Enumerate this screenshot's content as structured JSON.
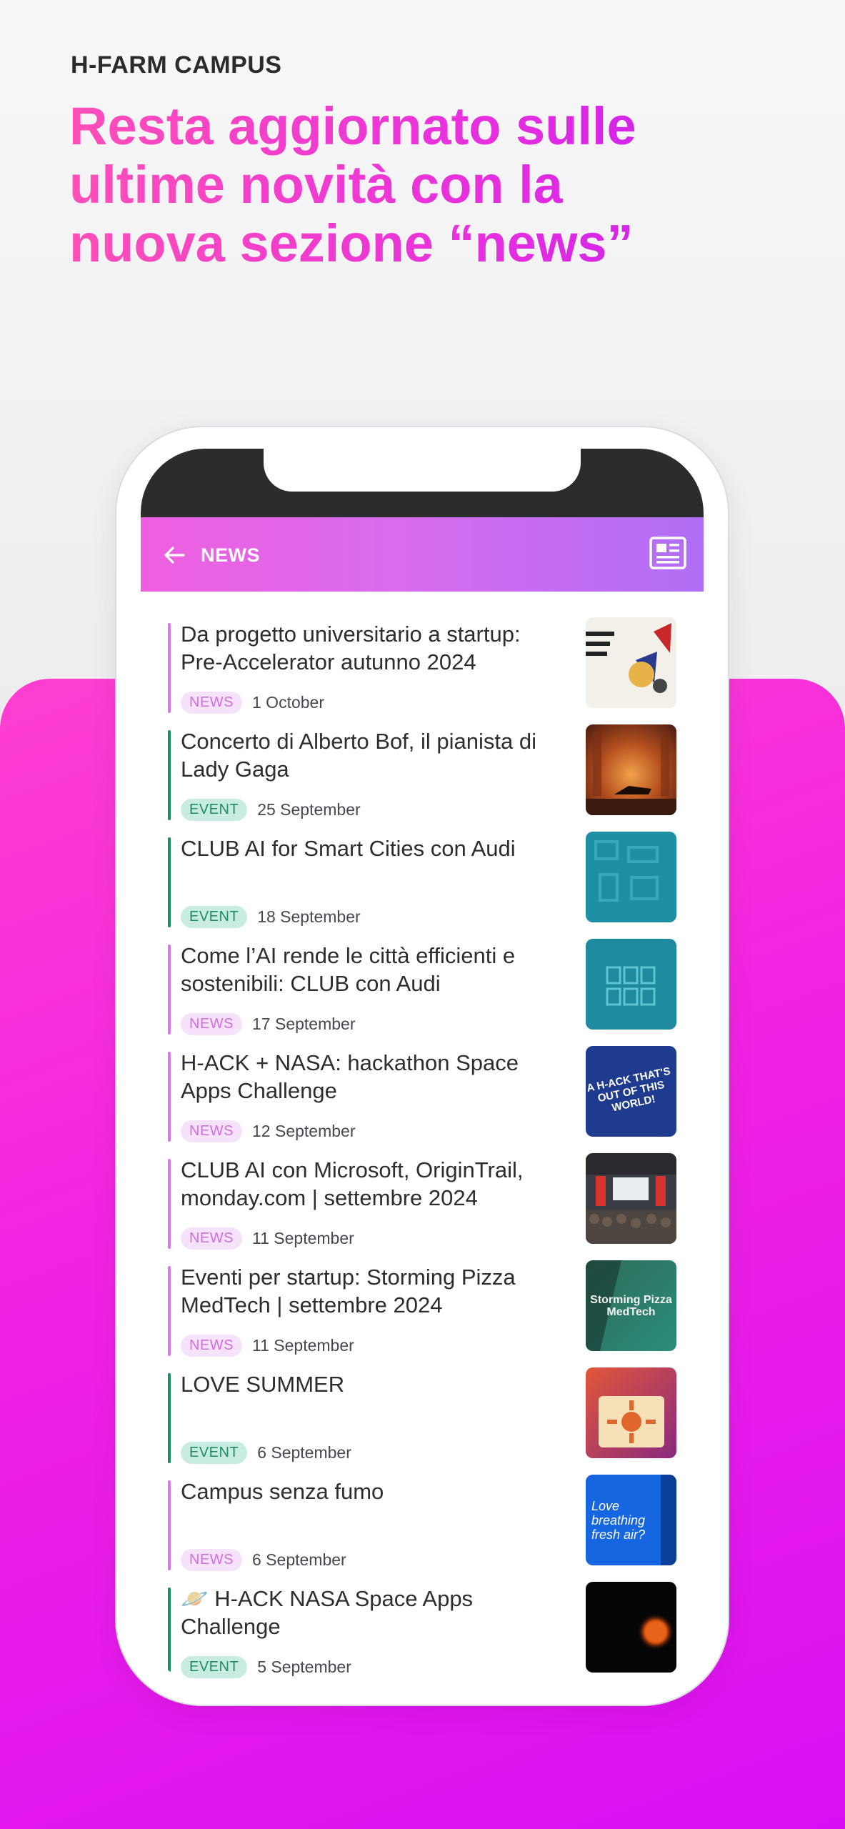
{
  "header": {
    "brand": "H-FARM CAMPUS",
    "headline_lines": [
      "Resta aggiornato sulle",
      "ultime novità con la",
      "nuova sezione “news”"
    ]
  },
  "colors": {
    "pink_gradient_start": "#ff3fd0",
    "pink_gradient_end": "#d90ff3",
    "news_accent": "#cf6fe0",
    "event_accent": "#1f8a6a"
  },
  "app": {
    "title": "NEWS",
    "back_icon": "arrow-left-icon",
    "news_icon": "newspaper-icon"
  },
  "items": [
    {
      "title": "Da progetto universitario a startup: Pre-Accelerator autunno 2024",
      "badge": "NEWS",
      "type": "news",
      "date": "1 October"
    },
    {
      "title": "Concerto di Alberto Bof, il pianista di Lady Gaga",
      "badge": "EVENT",
      "type": "event",
      "date": "25 September"
    },
    {
      "title": "CLUB AI for Smart Cities con Audi",
      "badge": "EVENT",
      "type": "event",
      "date": "18 September"
    },
    {
      "title": "Come l’AI rende le città efficienti e sostenibili: CLUB con Audi",
      "badge": "NEWS",
      "type": "news",
      "date": "17 September"
    },
    {
      "title": "H-ACK + NASA: hackathon Space Apps Challenge",
      "badge": "NEWS",
      "type": "news",
      "date": "12 September",
      "thumb_text": "A H-ACK THAT'S OUT OF THIS WORLD!"
    },
    {
      "title": "CLUB AI con Microsoft, OriginTrail, monday.com | settembre 2024",
      "badge": "NEWS",
      "type": "news",
      "date": "11 September"
    },
    {
      "title": "Eventi per startup: Storming Pizza MedTech | settembre 2024",
      "badge": "NEWS",
      "type": "news",
      "date": "11 September",
      "thumb_text": "Storming Pizza MedTech"
    },
    {
      "title": "LOVE SUMMER",
      "badge": "EVENT",
      "type": "event",
      "date": "6 September"
    },
    {
      "title": "Campus senza fumo",
      "badge": "NEWS",
      "type": "news",
      "date": "6 September",
      "thumb_text": "Love breathing fresh air?"
    },
    {
      "title": "🪐 H-ACK NASA Space Apps Challenge",
      "badge": "EVENT",
      "type": "event",
      "date": "5 September"
    }
  ]
}
